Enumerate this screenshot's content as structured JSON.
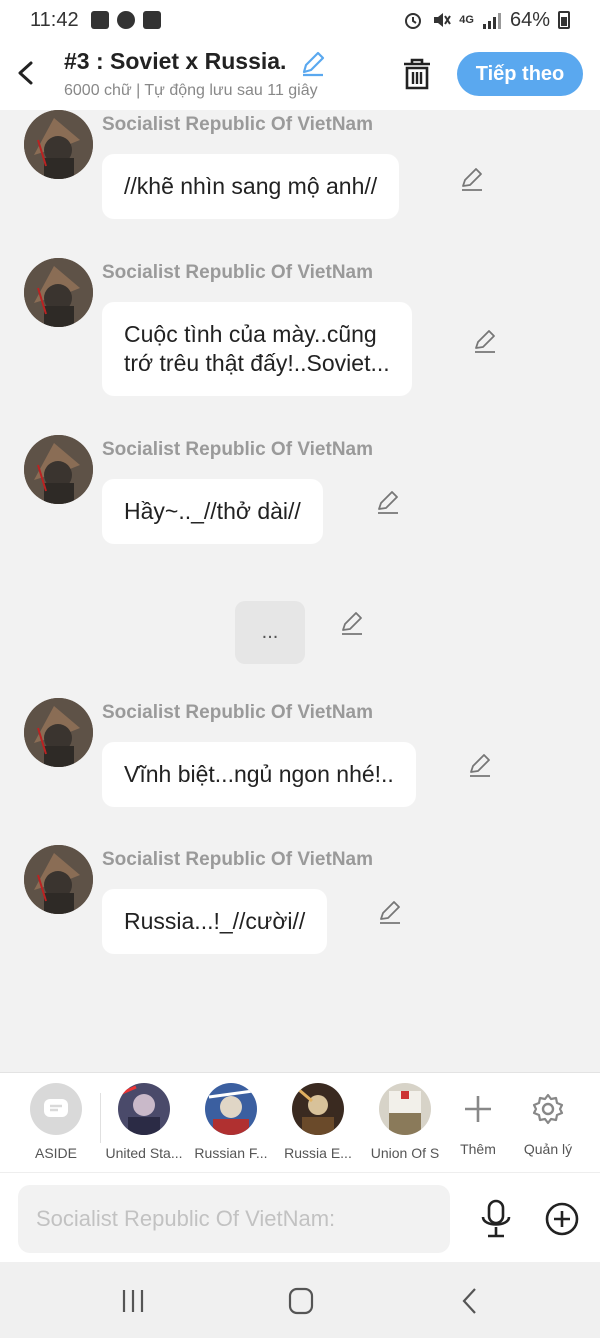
{
  "status_bar": {
    "time": "11:42",
    "battery": "64%",
    "network": "4G"
  },
  "header": {
    "title": "#3 : Soviet x Russia.",
    "subtitle": "6000 chữ | Tự động lưu sau 11 giây",
    "next_label": "Tiếp theo"
  },
  "messages": [
    {
      "sender": "Socialist Republic Of VietNam",
      "text_lines": [
        "//khẽ nhìn sang mộ anh//"
      ]
    },
    {
      "sender": "Socialist Republic Of VietNam",
      "text_lines": [
        "Cuộc tình của mày..cũng",
        "trớ trêu thật đấy!..Soviet..."
      ]
    },
    {
      "sender": "Socialist Republic Of VietNam",
      "text_lines": [
        "Hầy~.._//thở dài//"
      ]
    },
    {
      "sender": "Socialist Republic Of VietNam",
      "text_lines": [
        "Vĩnh biệt...ngủ ngon nhé!.."
      ]
    },
    {
      "sender": "Socialist Republic Of VietNam",
      "text_lines": [
        "Russia...!_//cười//"
      ]
    }
  ],
  "aside_message": {
    "text": "..."
  },
  "characters": [
    {
      "label": "ASIDE"
    },
    {
      "label": "United Sta..."
    },
    {
      "label": "Russian F..."
    },
    {
      "label": "Russia E..."
    },
    {
      "label": "Union Of S"
    }
  ],
  "actions": {
    "add_label": "Thêm",
    "manage_label": "Quản lý"
  },
  "input": {
    "placeholder": "Socialist Republic Of VietNam:"
  },
  "colors": {
    "accent": "#5aa8ef",
    "background": "#f2f2f2",
    "sender": "#9a9a9a"
  }
}
